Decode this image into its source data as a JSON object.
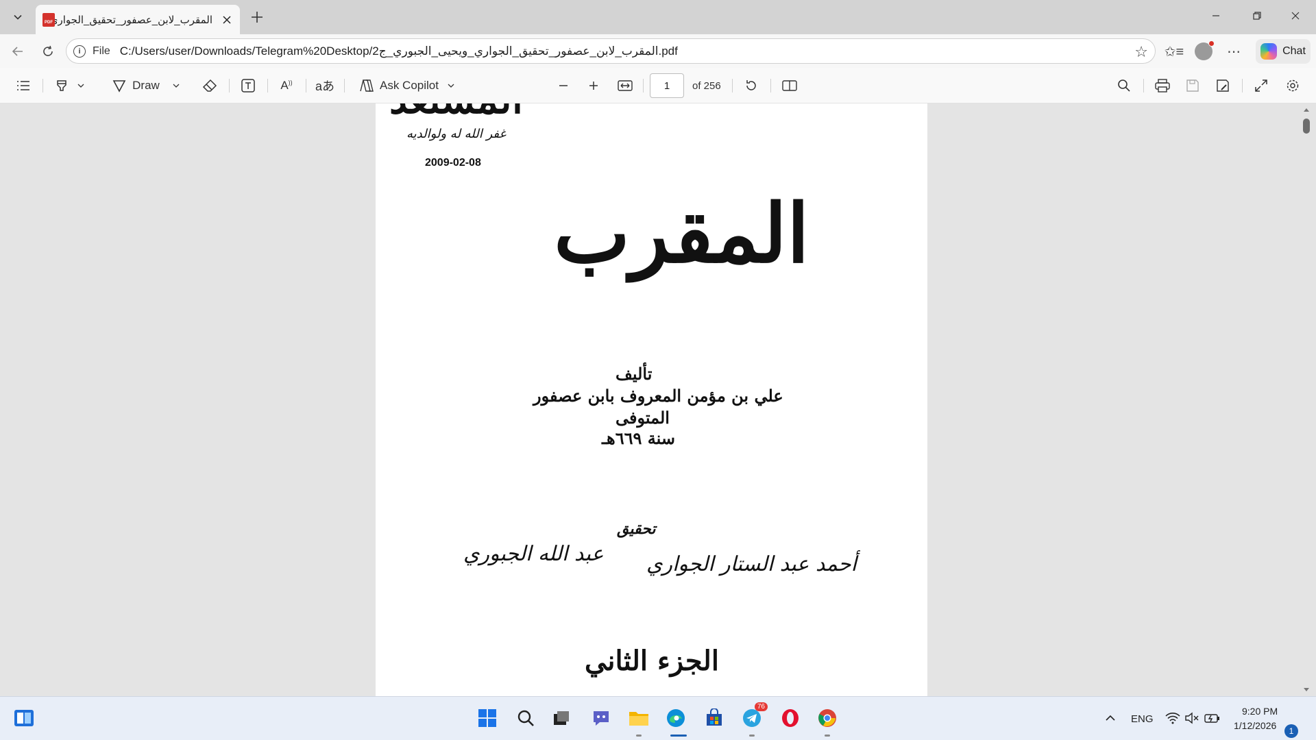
{
  "browser": {
    "tab": {
      "title": "المقرب_لابن_عصفور_تحقيق_الجواري..."
    },
    "address": {
      "scheme_label": "File",
      "url": "C:/Users/user/Downloads/Telegram%20Desktop/المقرب_لابن_عصفور_تحقيق_الجواري_ويحيى_الجبوري_ج2.pdf"
    },
    "chat_label": "Chat"
  },
  "pdf_toolbar": {
    "draw_label": "Draw",
    "ask_copilot_label": "Ask Copilot",
    "page_number": "1",
    "page_count": "of 256"
  },
  "document": {
    "date_stamp": "2009-02-08",
    "stamp_inscription": "غفر الله له ولوالديه",
    "header_fragment": "المستعد",
    "title_calligraphy": "المقرب",
    "author_heading": "تأليف",
    "author_name": "علي بن مؤمن المعروف بابن عصفور",
    "deceased_label": "المتوفى",
    "death_year": "سنة ٦٦٩هـ",
    "editing_heading": "تحقيق",
    "editor_1": "أحمد عبد الستار الجواري",
    "editor_2": "عبد الله الجبوري",
    "volume": "الجزء الثاني"
  },
  "taskbar": {
    "language": "ENG",
    "time": "9:20 PM",
    "date": "1/12/2026",
    "telegram_badge": "76",
    "notification_count": "1"
  }
}
